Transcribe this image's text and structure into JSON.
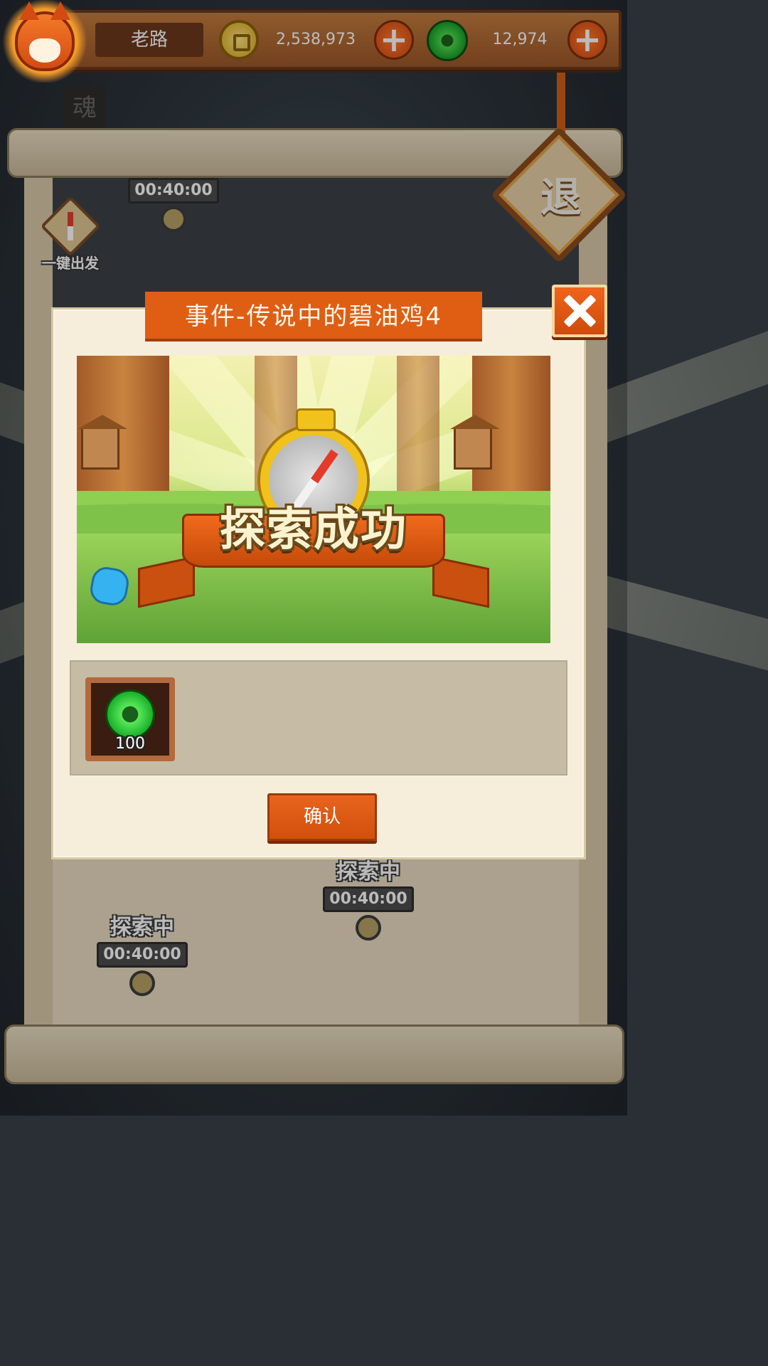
{
  "player": {
    "name": "老路",
    "coins": "2,538,973",
    "jade": "12,974"
  },
  "background": {
    "scroll_tag": "魂",
    "quick_depart_label": "一键出发",
    "exit_label": "退",
    "in_progress": [
      {
        "title": "探索中",
        "timer": "00:40:00"
      },
      {
        "title": "探索中",
        "timer": "00:40:00"
      }
    ],
    "partial_timer": "00:40:00"
  },
  "modal": {
    "title": "事件-传说中的碧油鸡4",
    "banner_text": "探索成功",
    "rewards": [
      {
        "icon": "jade-icon",
        "count": "100"
      }
    ],
    "confirm_label": "确认"
  },
  "colors": {
    "accent": "#df5e14",
    "panel": "#f6eedb",
    "reward_panel": "#c6bca6"
  }
}
